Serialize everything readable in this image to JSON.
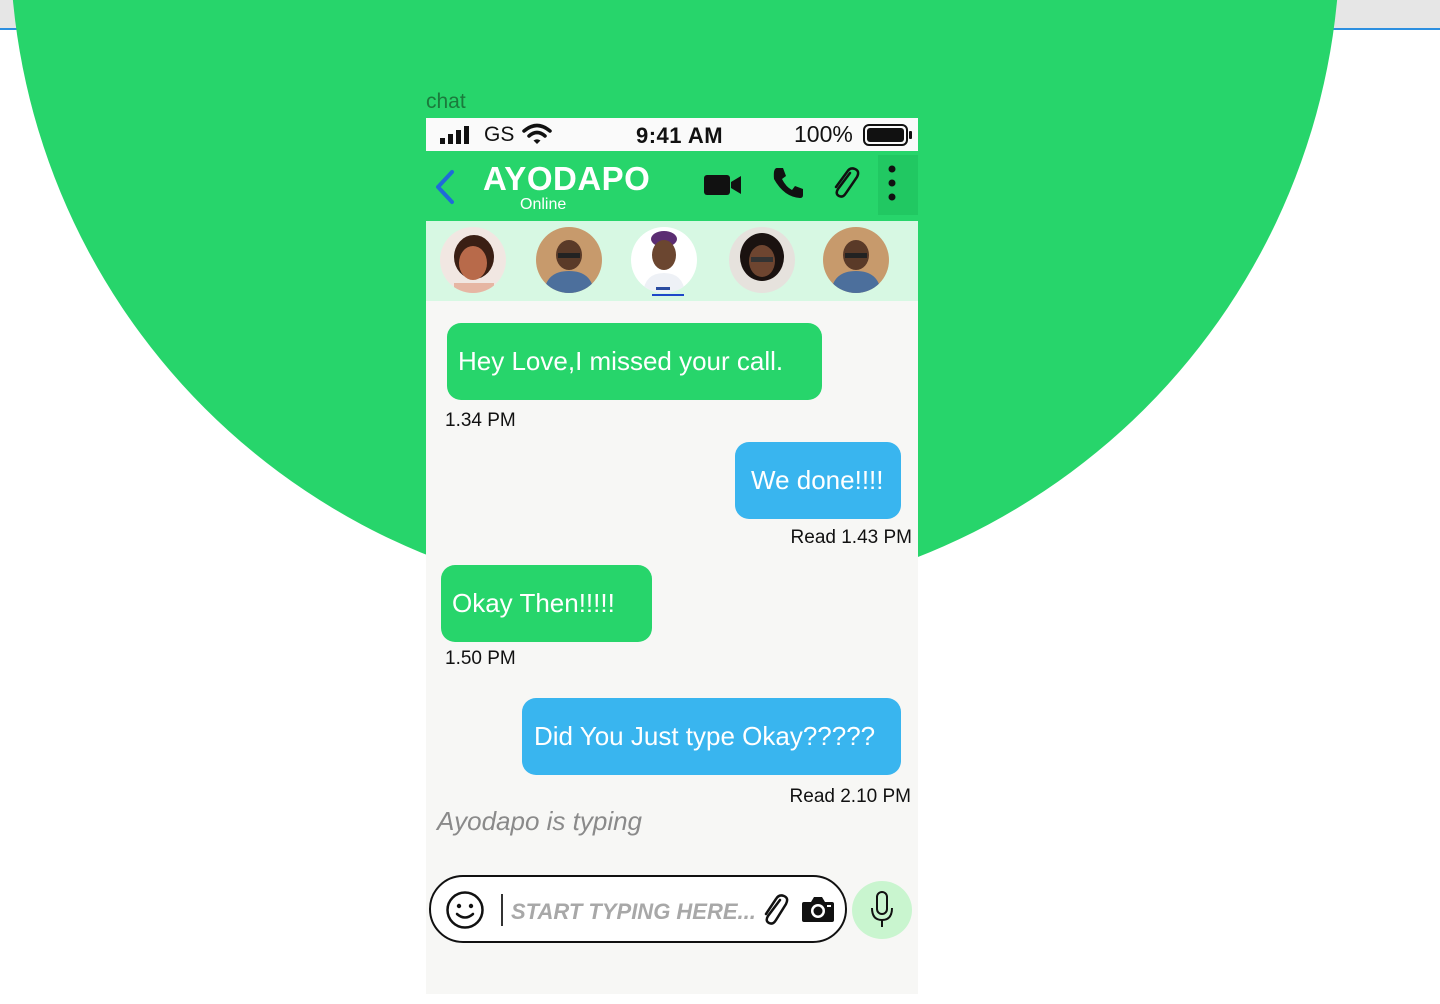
{
  "frame_label": "chat",
  "status_bar": {
    "carrier": "GS",
    "time": "9:41 AM",
    "battery": "100%"
  },
  "header": {
    "name": "AYODAPO",
    "status": "Online"
  },
  "messages": [
    {
      "text": "Hey Love,I missed your call.",
      "meta": "1.34 PM"
    },
    {
      "text": "We done!!!!",
      "meta": "Read 1.43 PM"
    },
    {
      "text": "Okay Then!!!!!",
      "meta": "1.50  PM"
    },
    {
      "text": "Did You Just type Okay?????",
      "meta": "Read 2.10 PM"
    }
  ],
  "typing_indicator": "Ayodapo is typing",
  "composer": {
    "placeholder": "START TYPING HERE..."
  },
  "colors": {
    "brand_green": "#27d56b",
    "outgoing_blue": "#39b5ef",
    "stories_bg": "#d7f8e3"
  }
}
